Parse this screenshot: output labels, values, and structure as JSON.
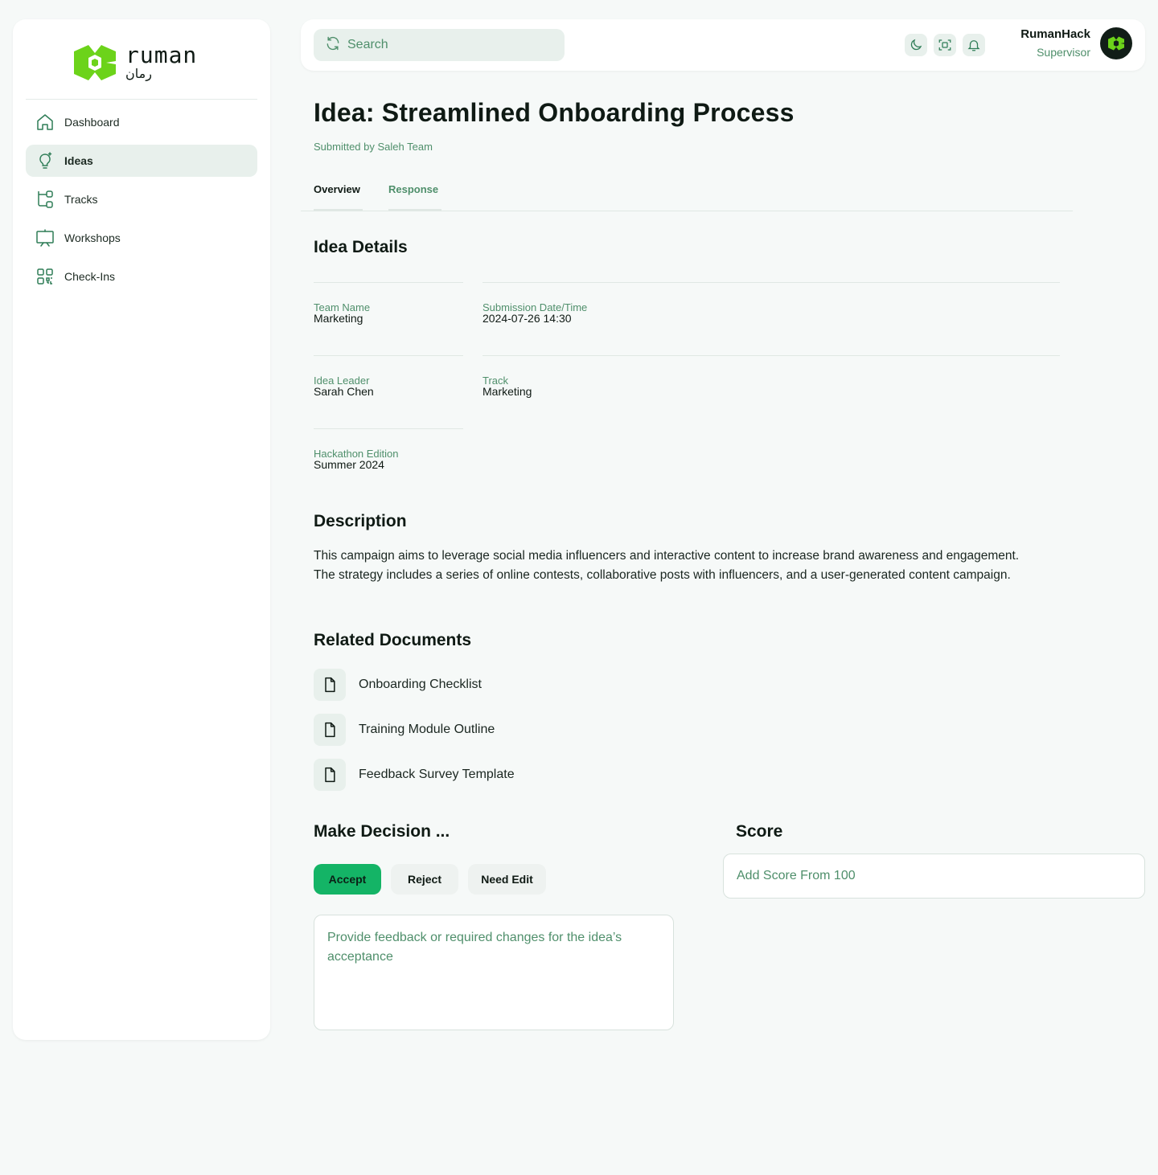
{
  "brand": {
    "name_latin": "ruman",
    "name_arabic": "رمان",
    "accent": "#6cd31a",
    "primary_green": "#14b466",
    "muted_green": "#4f8f6b"
  },
  "sidebar": {
    "items": [
      {
        "label": "Dashboard",
        "icon": "home-icon",
        "active": false
      },
      {
        "label": "Ideas",
        "icon": "lightbulb-icon",
        "active": true
      },
      {
        "label": "Tracks",
        "icon": "tracks-icon",
        "active": false
      },
      {
        "label": "Workshops",
        "icon": "presentation-icon",
        "active": false
      },
      {
        "label": "Check-Ins",
        "icon": "qr-code-icon",
        "active": false
      }
    ]
  },
  "header": {
    "search_placeholder": "Search",
    "icons": [
      "moon-icon",
      "scan-icon",
      "bell-icon"
    ],
    "user": {
      "name": "RumanHack",
      "role": "Supervisor"
    }
  },
  "page": {
    "title": "Idea: Streamlined Onboarding Process",
    "subtitle": "Submitted by Saleh Team",
    "tabs": [
      {
        "label": "Overview",
        "active": true
      },
      {
        "label": "Response",
        "active": false
      }
    ]
  },
  "details": {
    "heading": "Idea Details",
    "team_name": {
      "label": "Team Name",
      "value": "Marketing"
    },
    "submission": {
      "label": "Submission Date/Time",
      "value": "2024-07-26 14:30"
    },
    "leader": {
      "label": "Idea Leader",
      "value": "Sarah Chen"
    },
    "track": {
      "label": "Track",
      "value": "Marketing"
    },
    "edition": {
      "label": "Hackathon Edition",
      "value": "Summer 2024"
    }
  },
  "description": {
    "heading": "Description",
    "text": "This campaign aims to leverage social media influencers and interactive content to increase brand awareness and engagement. The strategy includes a series of online contests, collaborative posts with influencers, and a user-generated content campaign."
  },
  "documents": {
    "heading": "Related Documents",
    "items": [
      "Onboarding Checklist",
      "Training Module Outline",
      "Feedback Survey Template"
    ]
  },
  "decision": {
    "heading": "Make Decision ...",
    "accept": "Accept",
    "reject": "Reject",
    "need_edit": "Need Edit",
    "feedback_placeholder": "Provide feedback or required changes for the idea’s acceptance"
  },
  "score": {
    "heading": "Score",
    "placeholder": "Add Score From 100"
  }
}
